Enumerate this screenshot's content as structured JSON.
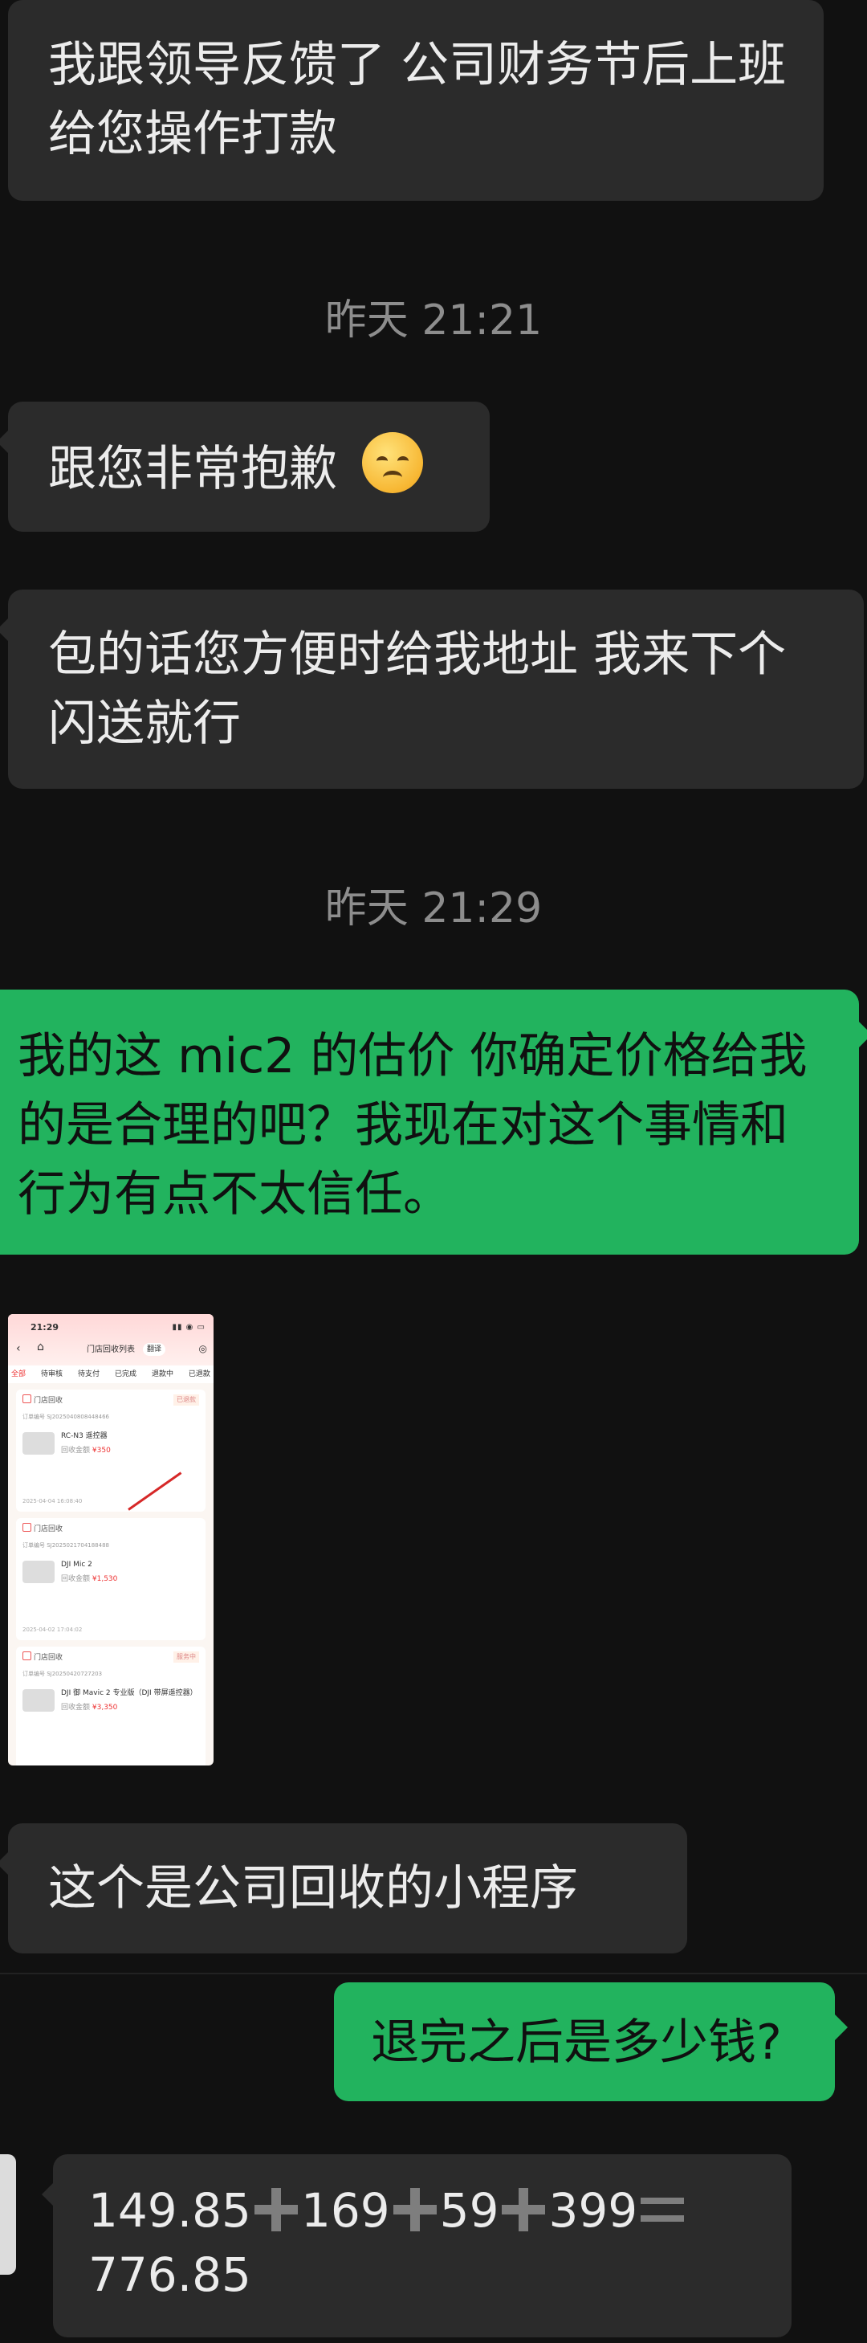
{
  "messages": [
    {
      "id": "m1",
      "text": "我跟领导反馈了 公司财务节后上班给您操作打款"
    },
    {
      "id": "ts1",
      "time": "昨天 21:21"
    },
    {
      "id": "m2",
      "text": "跟您非常抱歉",
      "emoji": "disappointed-face-emoji"
    },
    {
      "id": "m3",
      "text": "包的话您方便时给我地址 我来下个闪送就行"
    },
    {
      "id": "ts2",
      "time": "昨天 21:29"
    },
    {
      "id": "m4",
      "text": "我的这 mic2 的估价 你确定价格给我的是合理的吧？我现在对这个事情和行为有点不太信任。"
    },
    {
      "id": "m5",
      "type": "image"
    },
    {
      "id": "m6",
      "text": "这个是公司回收的小程序"
    },
    {
      "id": "m7",
      "text": "退完之后是多少钱?"
    },
    {
      "id": "m8",
      "parts": [
        "149.85",
        "169",
        "59",
        "399"
      ],
      "result": "776.85"
    }
  ],
  "thumbnail": {
    "status_time": "21:29",
    "title": "门店回收列表",
    "pill": "翻译",
    "tabs": [
      "全部",
      "待审核",
      "待支付",
      "已完成",
      "退款中",
      "已退款"
    ],
    "orders": [
      {
        "shop": "门店回收",
        "tag": "已退款",
        "order_no": "订单编号 SJ2025040808448466",
        "product": "RC-N3 遥控器",
        "price_label": "回收金额",
        "price": "¥350",
        "date": "2025-04-04 16:08:40"
      },
      {
        "shop": "门店回收",
        "tag": "",
        "order_no": "订单编号 SJ2025021704188488",
        "product": "DJI Mic 2",
        "price_label": "回收金额",
        "price": "¥1,530",
        "date": "2025-04-02 17:04:02"
      },
      {
        "shop": "门店回收",
        "tag": "服务中",
        "order_no": "订单编号 SJ20250420727203",
        "product": "DJI 御 Mavic 2 专业版（DJI 带屏遥控器）",
        "price_label": "回收金额",
        "price": "¥3,350",
        "date": ""
      }
    ]
  },
  "colors": {
    "background": "#111111",
    "incoming": "#2b2b2b",
    "outgoing": "#22b35e",
    "timestamp": "#8d8d8d"
  }
}
